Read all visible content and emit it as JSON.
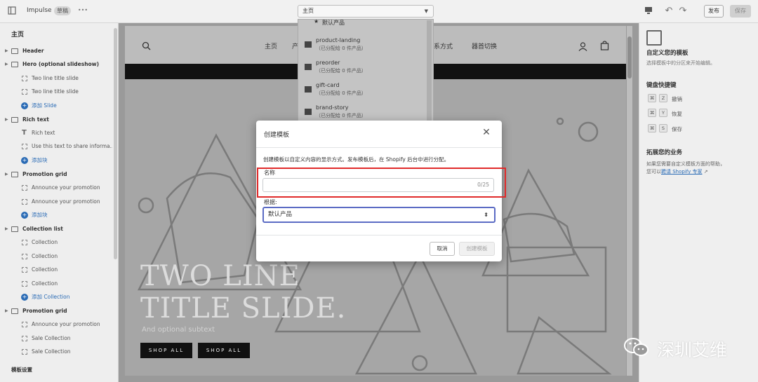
{
  "topbar": {
    "theme_name": "Impulse",
    "badge": "草稿",
    "more": "•••",
    "page_select": "主页",
    "save_label": "发布",
    "publish_label": "保存"
  },
  "sidebar": {
    "title": "主页",
    "rows": [
      {
        "kind": "section",
        "label": "Header"
      },
      {
        "kind": "section",
        "label": "Hero (optional slideshow)"
      },
      {
        "kind": "block",
        "label": "Two line title slide"
      },
      {
        "kind": "block",
        "label": "Two line title slide"
      },
      {
        "kind": "add",
        "label": "添加 Slide"
      },
      {
        "kind": "section",
        "label": "Rich text"
      },
      {
        "kind": "text",
        "label": "Rich text"
      },
      {
        "kind": "block",
        "label": "Use this text to share informa..."
      },
      {
        "kind": "add",
        "label": "添加块"
      },
      {
        "kind": "section",
        "label": "Promotion grid"
      },
      {
        "kind": "block",
        "label": "Announce your promotion"
      },
      {
        "kind": "block",
        "label": "Announce your promotion"
      },
      {
        "kind": "add",
        "label": "添加块"
      },
      {
        "kind": "section",
        "label": "Collection list"
      },
      {
        "kind": "block",
        "label": "Collection"
      },
      {
        "kind": "block",
        "label": "Collection"
      },
      {
        "kind": "block",
        "label": "Collection"
      },
      {
        "kind": "block",
        "label": "Collection"
      },
      {
        "kind": "add",
        "label": "添加 Collection"
      },
      {
        "kind": "section",
        "label": "Promotion grid"
      },
      {
        "kind": "block",
        "label": "Announce your promotion"
      },
      {
        "kind": "block",
        "label": "Sale Collection"
      },
      {
        "kind": "block",
        "label": "Sale Collection"
      }
    ],
    "footer": "模板设置"
  },
  "dropdown": {
    "items": [
      {
        "label": "默认产品",
        "sub": ""
      },
      {
        "label": "product-landing",
        "sub": "（已分配给 0 件产品）"
      },
      {
        "label": "preorder",
        "sub": "（已分配给 0 件产品）"
      },
      {
        "label": "gift-card",
        "sub": "（已分配给 0 件产品）"
      },
      {
        "label": "brand-story",
        "sub": "（已分配给 0 件产品）"
      }
    ]
  },
  "preview": {
    "nav": [
      "主页",
      "产",
      "系方式",
      "器首切换"
    ],
    "hero_line1": "TWO LINE",
    "hero_line2": "TITLE SLIDE.",
    "hero_sub": "And optional subtext",
    "btn1": "SHOP ALL",
    "btn2": "SHOP ALL"
  },
  "right_panel": {
    "title": "自定义您的模板",
    "desc": "选择模板中的分区来开始编辑。",
    "shortcuts_title": "键盘快捷键",
    "shortcuts": [
      {
        "k1": "⌘",
        "k2": "Z",
        "label": "撤销"
      },
      {
        "k1": "⌘",
        "k2": "Y",
        "label": "恢复"
      },
      {
        "k1": "⌘",
        "k2": "S",
        "label": "保存"
      }
    ],
    "expand_title": "拓展您的业务",
    "expand_text1": "如果您需要自定义模板方面的帮助，",
    "expand_text2": "您可以",
    "expand_link": "聘请 Shopify 专家"
  },
  "modal": {
    "title": "创建模板",
    "description": "创建模板以自定义内容的显示方式。发布模板后，在 Shopify 后台中进行分配。",
    "name_label": "名称",
    "name_value": "",
    "counter": "0/25",
    "based_label": "根据:",
    "based_value": "默认产品",
    "cancel": "取消",
    "create": "创建模板"
  },
  "watermark": "深圳艾维"
}
